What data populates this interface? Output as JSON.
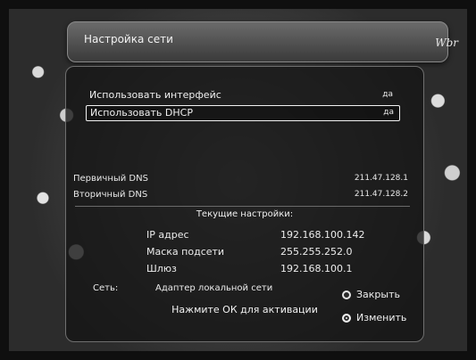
{
  "title": "Настройка сети",
  "logo": "Wbr",
  "options": [
    {
      "label": "Использовать интерфейс",
      "value": "да"
    },
    {
      "label": "Использовать DHCP",
      "value": "да"
    }
  ],
  "dns": [
    {
      "label": "Первичный DNS",
      "value": "211.47.128.1"
    },
    {
      "label": "Вторичный DNS",
      "value": "211.47.128.2"
    }
  ],
  "current_settings_heading": "Текущие настройки:",
  "current": [
    {
      "label": "IP адрес",
      "value": "192.168.100.142"
    },
    {
      "label": "Маска подсети",
      "value": "255.255.252.0"
    },
    {
      "label": "Шлюз",
      "value": "192.168.100.1"
    }
  ],
  "network": {
    "label": "Сеть:",
    "value": "Адаптер локальной сети"
  },
  "hint": "Нажмите ОК для активации",
  "actions": {
    "close": "Закрыть",
    "change": "Изменить"
  }
}
